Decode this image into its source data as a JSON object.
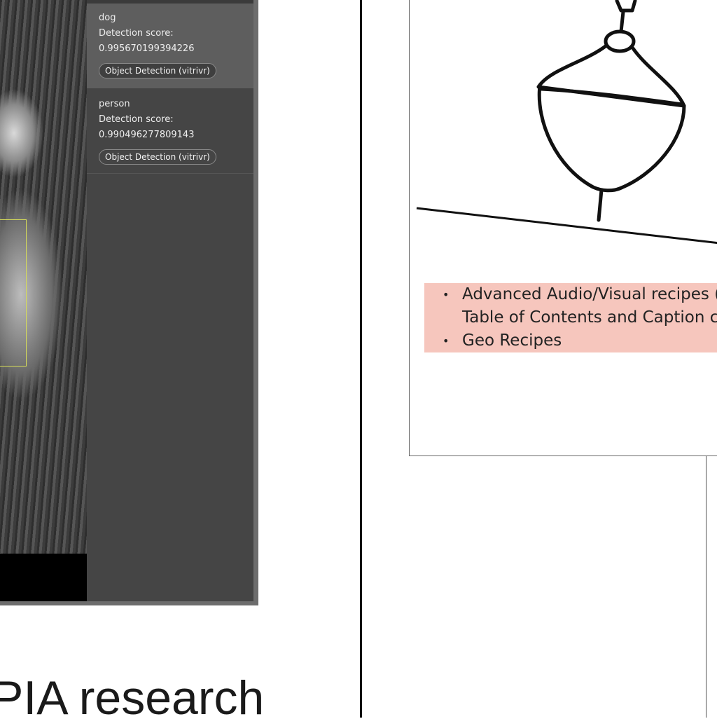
{
  "detections": [
    {
      "label": "dog",
      "score_label": "Detection score:",
      "score": "0.995670199394226",
      "source": "Object Detection (vitrivr)"
    },
    {
      "label": "person",
      "score_label": "Detection score:",
      "score": "0.990496277809143",
      "source": "Object Detection (vitrivr)"
    }
  ],
  "caption": "PIA research",
  "slide": {
    "bullets": [
      {
        "lines": [
          "Advanced Audio/Visual recipes (s",
          "Table of Contents and Caption ca"
        ]
      },
      {
        "lines": [
          "Geo Recipes"
        ]
      }
    ],
    "bullet_glyph": "•",
    "highlight_color": "#f6c6bd"
  },
  "colors": {
    "bbox": "#d7dd5a",
    "sidebar": "#454545",
    "active_row": "#5e5e5e"
  }
}
